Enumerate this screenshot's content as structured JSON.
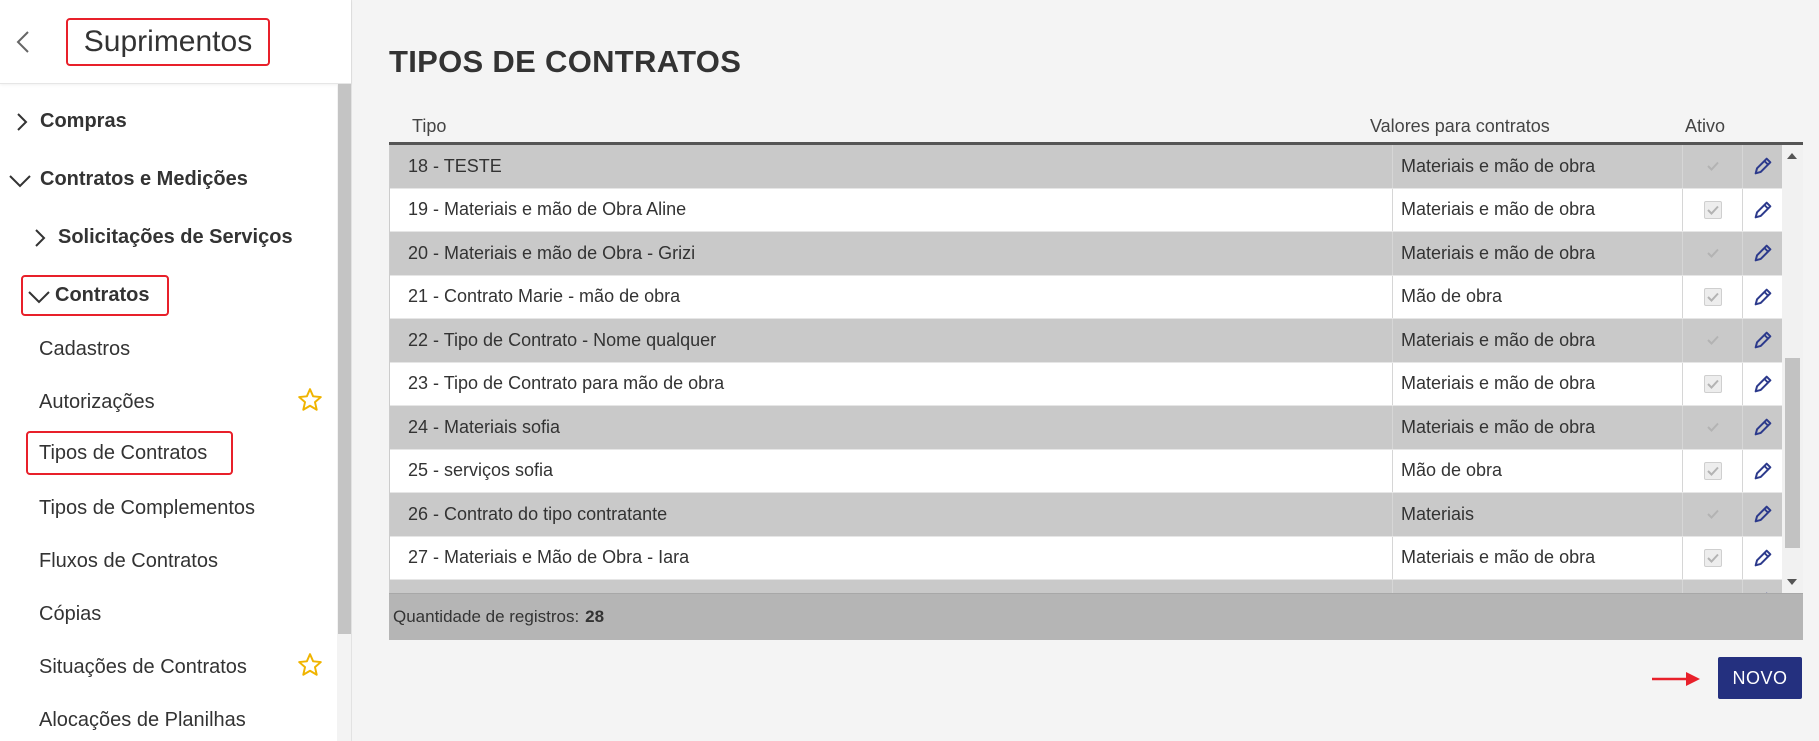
{
  "sidebar": {
    "title": "Suprimentos",
    "nav": {
      "compras": "Compras",
      "contratos_medicoes": "Contratos e Medições",
      "solicitacoes": "Solicitações de Serviços",
      "contratos": "Contratos",
      "sub_items": [
        "Cadastros",
        "Autorizações",
        "Tipos de Contratos",
        "Tipos de Complementos",
        "Fluxos de Contratos",
        "Cópias",
        "Situações de Contratos",
        "Alocações de Planilhas"
      ]
    }
  },
  "main": {
    "title": "TIPOS DE CONTRATOS",
    "columns": {
      "tipo": "Tipo",
      "valores": "Valores para contratos",
      "ativo": "Ativo"
    },
    "rows": [
      {
        "tipo": "18 - TESTE",
        "valor": "Materiais e mão de obra"
      },
      {
        "tipo": "19 - Materiais e mão de Obra Aline",
        "valor": "Materiais e mão de obra"
      },
      {
        "tipo": "20 - Materiais e mão de Obra - Grizi",
        "valor": "Materiais e mão de obra"
      },
      {
        "tipo": "21 - Contrato Marie - mão de obra",
        "valor": "Mão de obra"
      },
      {
        "tipo": "22 - Tipo de Contrato - Nome qualquer",
        "valor": "Materiais e mão de obra"
      },
      {
        "tipo": "23 - Tipo de Contrato para mão de obra",
        "valor": "Materiais e mão de obra"
      },
      {
        "tipo": "24 - Materiais sofia",
        "valor": "Materiais e mão de obra"
      },
      {
        "tipo": "25 - serviços sofia",
        "valor": "Mão de obra"
      },
      {
        "tipo": "26 - Contrato do tipo contratante",
        "valor": "Materiais"
      },
      {
        "tipo": "27 - Materiais e Mão de Obra - Iara",
        "valor": "Materiais e mão de obra"
      },
      {
        "tipo": "",
        "valor": ""
      }
    ],
    "footer": {
      "label": "Quantidade de registros:",
      "count": "28"
    },
    "novo_label": "NOVO"
  },
  "colors": {
    "accent": "#24307f",
    "highlight": "#e8202a",
    "star": "#f0b400",
    "edit_icon": "#2c3a8c"
  }
}
